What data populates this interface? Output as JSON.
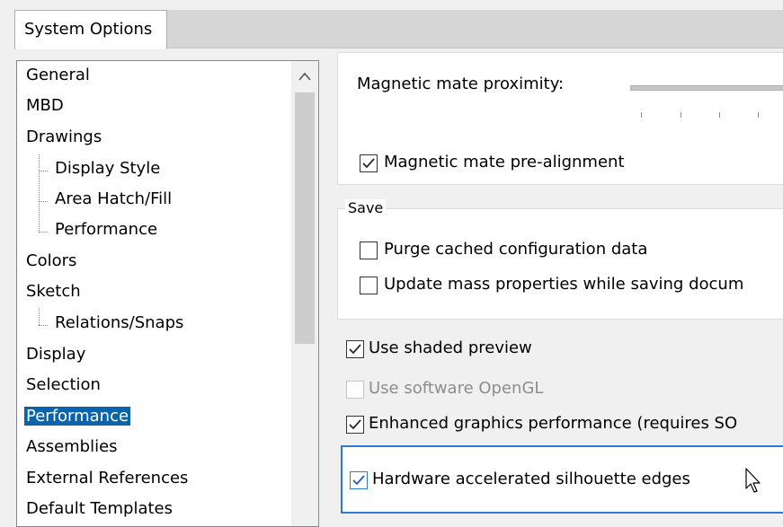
{
  "dialog": {
    "tab_label": "System Options"
  },
  "tree": {
    "items": [
      {
        "label": "General"
      },
      {
        "label": "MBD"
      },
      {
        "label": "Drawings"
      },
      {
        "label": "Display Style"
      },
      {
        "label": "Area Hatch/Fill"
      },
      {
        "label": "Performance"
      },
      {
        "label": "Colors"
      },
      {
        "label": "Sketch"
      },
      {
        "label": "Relations/Snaps"
      },
      {
        "label": "Display"
      },
      {
        "label": "Selection"
      },
      {
        "label": "Performance"
      },
      {
        "label": "Assemblies"
      },
      {
        "label": "External References"
      },
      {
        "label": "Default Templates"
      }
    ],
    "selected_index": 11
  },
  "panel": {
    "magnetic_proximity_label": "Magnetic mate proximity:",
    "magnetic_prealign": {
      "label": "Magnetic mate pre-alignment",
      "checked": true
    },
    "save_group": {
      "legend": "Save",
      "purge": {
        "label": "Purge cached configuration data",
        "checked": false
      },
      "update_mass": {
        "label": "Update mass properties while saving docum",
        "checked": false
      }
    },
    "shaded_preview": {
      "label": "Use shaded preview",
      "checked": true
    },
    "software_opengl": {
      "label": "Use software OpenGL",
      "checked": false,
      "enabled": false
    },
    "enhanced_graphics": {
      "label": "Enhanced graphics performance (requires SO",
      "checked": true
    },
    "hw_silhouette": {
      "label": "Hardware accelerated silhouette edges",
      "checked": true
    }
  },
  "colors": {
    "selection": "#0a64ad",
    "focus": "#2c7ad6"
  }
}
